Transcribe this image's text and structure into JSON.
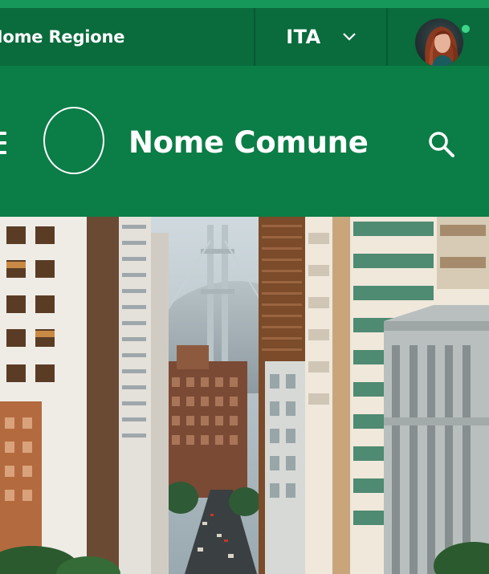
{
  "slim_header": {
    "region_label": "Nome Regione",
    "language": "ITA",
    "language_icon": "chevron-down-icon",
    "user_status": "online"
  },
  "header": {
    "title": "Nome Comune",
    "menu_icon": "hamburger-icon",
    "search_icon": "search-icon"
  },
  "colors": {
    "slim_header_bg": "#0a6b3d",
    "header_bg": "#0b7d46",
    "accent": "#16985a",
    "text": "#ffffff",
    "status": "#3fd68a"
  }
}
